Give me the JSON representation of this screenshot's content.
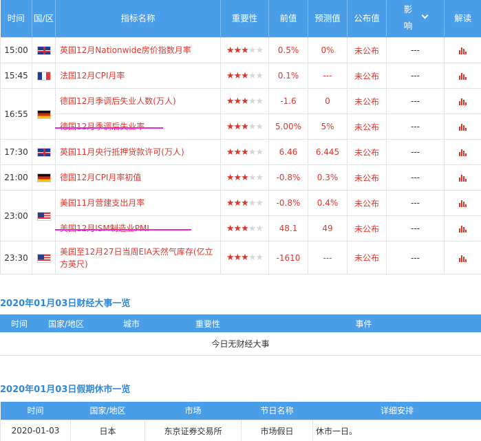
{
  "calendar": {
    "headers": [
      "时间",
      "国/区",
      "指标名称",
      "重要性",
      "前值",
      "预测值",
      "公布值",
      "影响",
      "解读"
    ],
    "rows": [
      {
        "time": "15:00",
        "flag": "uk-flag-icon",
        "name": "英国12月Nationwide房价指数月率",
        "stars": 3,
        "prev": "0.5%",
        "forecast": "0%",
        "actual": "未公布",
        "impact": "---"
      },
      {
        "time": "15:45",
        "flag": "france-flag-icon",
        "name": "法国12月CPI月率",
        "stars": 3,
        "prev": "0.1%",
        "forecast": "---",
        "actual": "未公布",
        "impact": "---"
      },
      {
        "time": "16:55",
        "flag": "germany-flag-icon",
        "name": "德国12月季调后失业人数(万人)",
        "stars": 3,
        "prev": "-1.6",
        "forecast": "0",
        "actual": "未公布",
        "impact": "---"
      },
      {
        "time": "",
        "flag": "",
        "name": "德国12月季调后失业率",
        "stars": 3,
        "prev": "5.00%",
        "forecast": "5%",
        "actual": "未公布",
        "impact": "---"
      },
      {
        "time": "17:30",
        "flag": "uk-flag-icon",
        "name": "英国11月央行抵押贷款许可(万人)",
        "stars": 3,
        "prev": "6.46",
        "forecast": "6.445",
        "actual": "未公布",
        "impact": "---"
      },
      {
        "time": "21:00",
        "flag": "germany-flag-icon",
        "name": "德国12月CPI月率初值",
        "stars": 3,
        "prev": "-0.8%",
        "forecast": "0.3%",
        "actual": "未公布",
        "impact": "---"
      },
      {
        "time": "23:00",
        "flag": "us-flag-icon",
        "name": "美国11月营建支出月率",
        "stars": 3,
        "prev": "-0.8%",
        "forecast": "0.4%",
        "actual": "未公布",
        "impact": "---"
      },
      {
        "time": "",
        "flag": "",
        "name": "美国12月ISM制造业PMI",
        "stars": 3,
        "prev": "48.1",
        "forecast": "49",
        "actual": "未公布",
        "impact": "---"
      },
      {
        "time": "23:30",
        "flag": "us-flag-icon",
        "name": "美国至12月27日当周EIA天然气库存(亿立方英尺)",
        "stars": 3,
        "prev": "-1610",
        "forecast": "---",
        "actual": "未公布",
        "impact": "---"
      }
    ]
  },
  "events_section": {
    "title": "2020年01月03日财经大事一览",
    "headers": [
      "时间",
      "国家/地区",
      "城市",
      "重要性",
      "事件"
    ],
    "empty_text": "今日无财经大事"
  },
  "holiday_section": {
    "title": "2020年01月03日假期休市一览",
    "headers": [
      "时间",
      "国家/地区",
      "市场",
      "节日名称",
      "详细安排"
    ],
    "rows": [
      {
        "date": "2020-01-03",
        "region": "日本",
        "market": "东京证券交易所",
        "holiday": "市场假日",
        "detail": "休市一日。"
      }
    ]
  },
  "colors": {
    "header_blue": "#4a9ee8",
    "value_red": "#e0352b",
    "highlight_magenta": "#e526e5",
    "title_blue": "#2e88d8"
  }
}
